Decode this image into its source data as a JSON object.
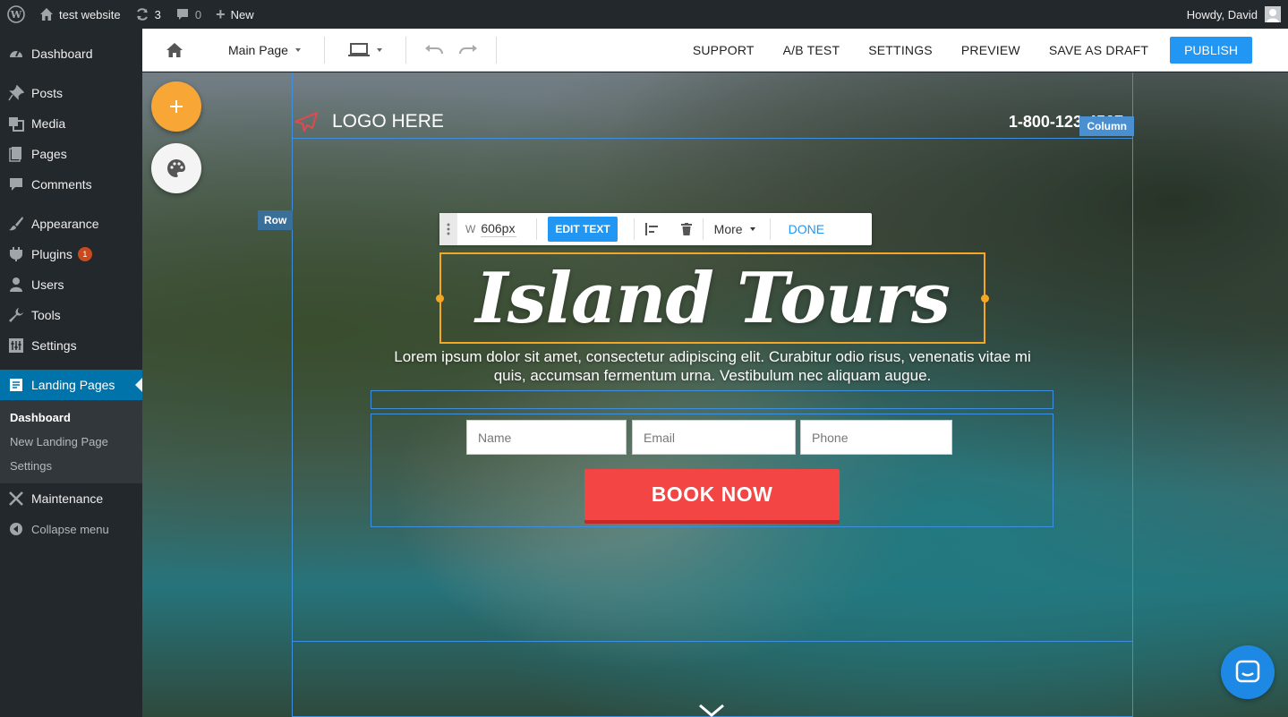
{
  "adminbar": {
    "site_name": "test website",
    "updates_count": "3",
    "comments_count": "0",
    "new_label": "New",
    "greeting": "Howdy, David"
  },
  "sidebar": {
    "items": [
      {
        "label": "Dashboard",
        "icon": "dashboard-icon"
      },
      {
        "label": "Posts",
        "icon": "pin-icon"
      },
      {
        "label": "Media",
        "icon": "media-icon"
      },
      {
        "label": "Pages",
        "icon": "pages-icon"
      },
      {
        "label": "Comments",
        "icon": "comments-icon"
      },
      {
        "label": "Appearance",
        "icon": "brush-icon"
      },
      {
        "label": "Plugins",
        "icon": "plugin-icon",
        "badge": "1"
      },
      {
        "label": "Users",
        "icon": "users-icon"
      },
      {
        "label": "Tools",
        "icon": "wrench-icon"
      },
      {
        "label": "Settings",
        "icon": "settings-icon"
      },
      {
        "label": "Landing Pages",
        "icon": "landing-icon",
        "current": true
      },
      {
        "label": "Maintenance",
        "icon": "tools-icon"
      },
      {
        "label": "Collapse menu",
        "icon": "collapse-icon"
      }
    ],
    "submenu": [
      "Dashboard",
      "New Landing Page",
      "Settings"
    ]
  },
  "toolbar": {
    "page_select": "Main Page",
    "actions": [
      "SUPPORT",
      "A/B TEST",
      "SETTINGS",
      "PREVIEW",
      "SAVE AS DRAFT"
    ],
    "publish": "PUBLISH"
  },
  "canvas": {
    "logo_text": "LOGO HERE",
    "phone": "1-800-123-4567",
    "column_tag": "Column",
    "row_tag": "Row",
    "editbar": {
      "width_label": "W",
      "width_value": "606px",
      "edit_text": "EDIT TEXT",
      "more": "More",
      "done": "DONE"
    },
    "title": "Island Tours",
    "body": "Lorem ipsum dolor sit amet, consectetur adipiscing elit. Curabitur odio risus, venenatis vitae mi quis, accumsan fermentum urna. Vestibulum nec aliquam augue.",
    "form": {
      "name_placeholder": "Name",
      "email_placeholder": "Email",
      "phone_placeholder": "Phone",
      "button": "BOOK NOW"
    }
  },
  "colors": {
    "admin_bg": "#23282d",
    "accent_blue": "#2196f3",
    "add_orange": "#f8a636",
    "book_red": "#f44545"
  }
}
